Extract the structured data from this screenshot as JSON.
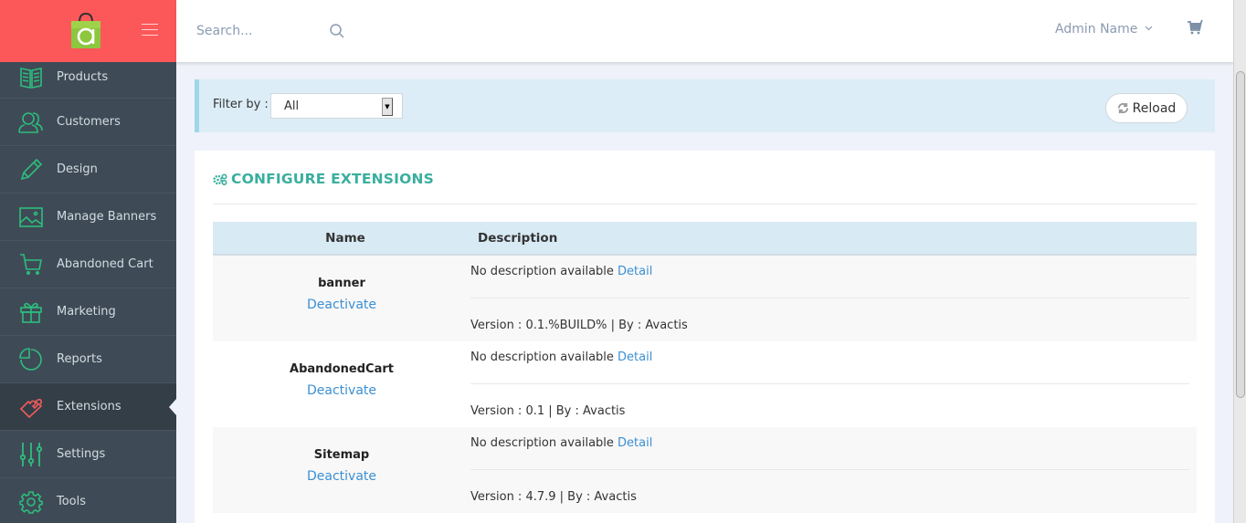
{
  "sidebar": {
    "brand_color": "#fc585a",
    "items": [
      {
        "label": "Products",
        "icon": "book-icon",
        "active": false
      },
      {
        "label": "Customers",
        "icon": "users-icon",
        "active": false
      },
      {
        "label": "Design",
        "icon": "pencil-icon",
        "active": false
      },
      {
        "label": "Manage Banners",
        "icon": "image-icon",
        "active": false
      },
      {
        "label": "Abandoned Cart",
        "icon": "cart-icon",
        "active": false
      },
      {
        "label": "Marketing",
        "icon": "gift-icon",
        "active": false
      },
      {
        "label": "Reports",
        "icon": "pie-chart-icon",
        "active": false
      },
      {
        "label": "Extensions",
        "icon": "puzzle-icon",
        "active": true
      },
      {
        "label": "Settings",
        "icon": "sliders-icon",
        "active": false
      },
      {
        "label": "Tools",
        "icon": "gear-icon",
        "active": false
      }
    ]
  },
  "topbar": {
    "search_placeholder": "Search...",
    "admin_name": "Admin Name",
    "admin_chevron": "⌄"
  },
  "filter": {
    "label": "Filter by :",
    "selected": "All",
    "reload_label": "Reload"
  },
  "panel": {
    "title": "CONFIGURE EXTENSIONS",
    "columns": [
      "Name",
      "Description"
    ],
    "rows": [
      {
        "name": "banner",
        "action": "Deactivate",
        "description": "No description available",
        "detail_link": "Detail",
        "version": "Version : 0.1.%BUILD% | By : Avactis"
      },
      {
        "name": "AbandonedCart",
        "action": "Deactivate",
        "description": "No description available",
        "detail_link": "Detail",
        "version": "Version : 0.1 | By : Avactis"
      },
      {
        "name": "Sitemap",
        "action": "Deactivate",
        "description": "No description available",
        "detail_link": "Detail",
        "version": "Version : 4.7.9 | By : Avactis"
      }
    ]
  },
  "colors": {
    "accent_green": "#2ebd7d",
    "active_icon": "#f05a5a",
    "title_teal": "#3aaf9e",
    "link_blue": "#3b8fd2"
  }
}
